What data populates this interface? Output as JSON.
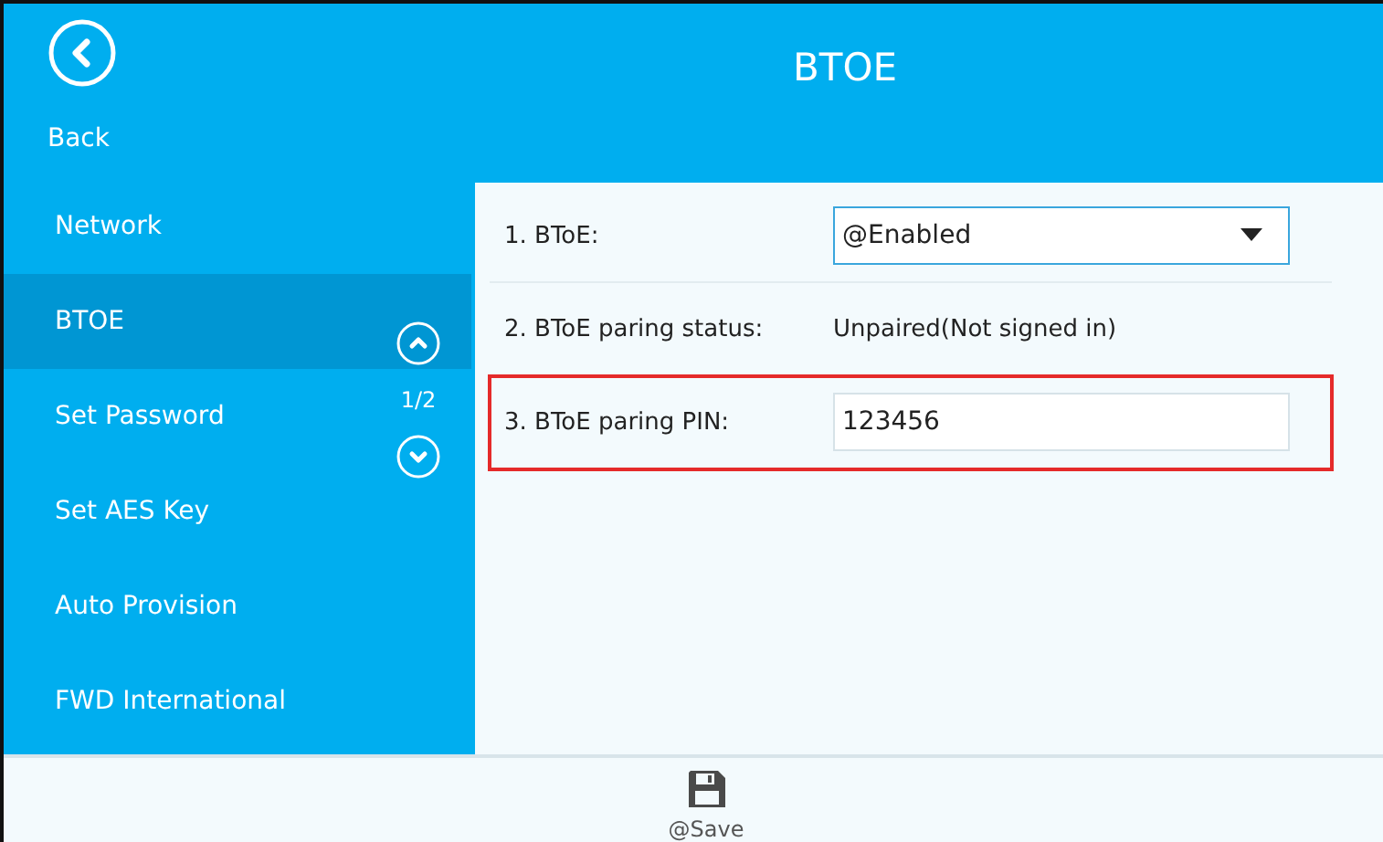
{
  "header": {
    "back_label": "Back",
    "title": "BTOE"
  },
  "sidebar": {
    "items": [
      {
        "label": "Network",
        "selected": false
      },
      {
        "label": "BTOE",
        "selected": true
      },
      {
        "label": "Set Password",
        "selected": false
      },
      {
        "label": "Set AES Key",
        "selected": false
      },
      {
        "label": "Auto Provision",
        "selected": false
      },
      {
        "label": "FWD International",
        "selected": false
      }
    ],
    "page_indicator": "1/2"
  },
  "settings": [
    {
      "kind": "dropdown",
      "label": "1. BToE:",
      "value": "@Enabled",
      "highlighted": false
    },
    {
      "kind": "text",
      "label": "2. BToE paring status:",
      "value": "Unpaired(Not signed in)",
      "highlighted": false
    },
    {
      "kind": "input",
      "label": "3. BToE paring PIN:",
      "value": "123456",
      "highlighted": true
    }
  ],
  "footer": {
    "save_label": "@Save"
  }
}
